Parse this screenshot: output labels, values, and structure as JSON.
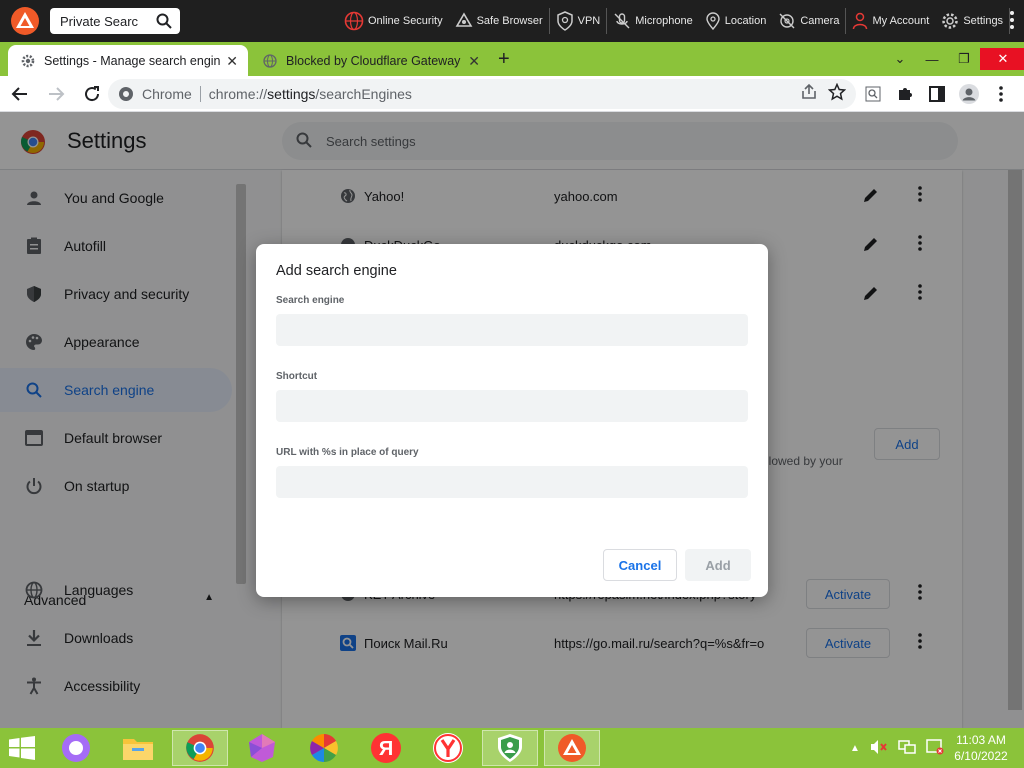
{
  "security_bar": {
    "search_value": "Private Searc",
    "items": [
      {
        "label": "Online Security",
        "icon": "globe-shield-icon"
      },
      {
        "label": "Safe Browser",
        "icon": "safe-browser-icon"
      },
      {
        "label": "VPN",
        "icon": "vpn-shield-icon"
      },
      {
        "label": "Microphone",
        "icon": "microphone-off-icon"
      },
      {
        "label": "Location",
        "icon": "location-pin-icon"
      },
      {
        "label": "Camera",
        "icon": "camera-off-icon"
      },
      {
        "label": "My Account",
        "icon": "user-icon"
      },
      {
        "label": "Settings",
        "icon": "gear-icon"
      }
    ]
  },
  "tabs": [
    {
      "title": "Settings - Manage search engine",
      "active": true
    },
    {
      "title": "Blocked by Cloudflare Gateway",
      "active": false
    }
  ],
  "omnibox": {
    "site_label": "Chrome",
    "url_prefix": "chrome://",
    "url_host": "settings",
    "url_path": "/searchEngines"
  },
  "settings": {
    "title": "Settings",
    "search_placeholder": "Search settings",
    "sidebar": [
      {
        "label": "You and Google",
        "icon": "person-icon"
      },
      {
        "label": "Autofill",
        "icon": "clipboard-icon"
      },
      {
        "label": "Privacy and security",
        "icon": "shield-icon"
      },
      {
        "label": "Appearance",
        "icon": "palette-icon"
      },
      {
        "label": "Search engine",
        "icon": "search-icon",
        "selected": true
      },
      {
        "label": "Default browser",
        "icon": "browser-window-icon"
      },
      {
        "label": "On startup",
        "icon": "power-icon"
      }
    ],
    "advanced_label": "Advanced",
    "advanced_items": [
      {
        "label": "Languages",
        "icon": "globe-icon"
      },
      {
        "label": "Downloads",
        "icon": "download-icon"
      },
      {
        "label": "Accessibility",
        "icon": "accessibility-icon"
      }
    ],
    "engines": [
      {
        "name": "Yahoo!",
        "url": "yahoo.com"
      },
      {
        "name": "DuckDuckGo",
        "url": "duckduckgo.com"
      }
    ],
    "card_add_label": "Add",
    "card_note": "llowed by your",
    "inactive_engines": [
      {
        "name": "KET Archive",
        "url": "https://repasim.net/index.php?story",
        "action": "Activate"
      },
      {
        "name": "Поиск Mail.Ru",
        "url": "https://go.mail.ru/search?q=%s&fr=o",
        "action": "Activate"
      }
    ]
  },
  "dialog": {
    "title": "Add search engine",
    "fields": [
      {
        "label": "Search engine",
        "value": ""
      },
      {
        "label": "Shortcut",
        "value": ""
      },
      {
        "label": "URL with %s in place of query",
        "value": ""
      }
    ],
    "cancel_label": "Cancel",
    "add_label": "Add"
  },
  "taskbar": {
    "time": "11:03 AM",
    "date": "6/10/2022"
  }
}
